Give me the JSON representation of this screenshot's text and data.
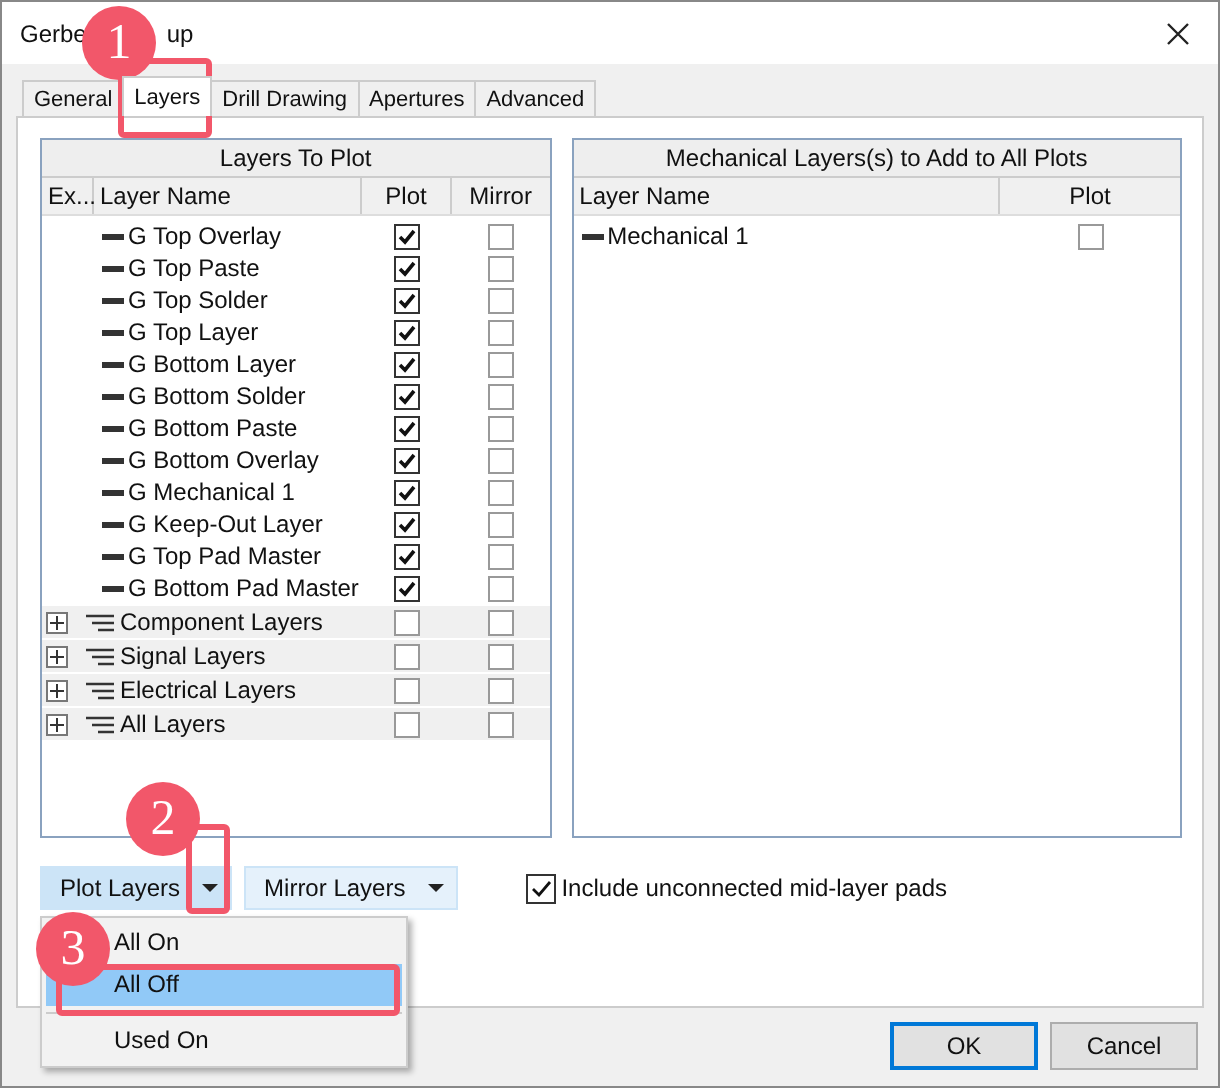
{
  "window": {
    "title_parts": [
      "Gerbe",
      "up"
    ]
  },
  "tabs": [
    {
      "label": "General",
      "selected": false
    },
    {
      "label": "Layers",
      "selected": true
    },
    {
      "label": "Drill Drawing",
      "selected": false
    },
    {
      "label": "Apertures",
      "selected": false
    },
    {
      "label": "Advanced",
      "selected": false
    }
  ],
  "layers_panel": {
    "title": "Layers To Plot",
    "columns": [
      "Ex...",
      "Layer Name",
      "Plot",
      "Mirror"
    ],
    "rows": [
      {
        "kind": "layer",
        "prefix": "G",
        "name": "Top Overlay",
        "plot": true,
        "mirror": false
      },
      {
        "kind": "layer",
        "prefix": "G",
        "name": "Top Paste",
        "plot": true,
        "mirror": false
      },
      {
        "kind": "layer",
        "prefix": "G",
        "name": "Top Solder",
        "plot": true,
        "mirror": false
      },
      {
        "kind": "layer",
        "prefix": "G",
        "name": "Top Layer",
        "plot": true,
        "mirror": false
      },
      {
        "kind": "layer",
        "prefix": "G",
        "name": "Bottom Layer",
        "plot": true,
        "mirror": false
      },
      {
        "kind": "layer",
        "prefix": "G",
        "name": "Bottom Solder",
        "plot": true,
        "mirror": false
      },
      {
        "kind": "layer",
        "prefix": "G",
        "name": "Bottom Paste",
        "plot": true,
        "mirror": false
      },
      {
        "kind": "layer",
        "prefix": "G",
        "name": "Bottom Overlay",
        "plot": true,
        "mirror": false
      },
      {
        "kind": "layer",
        "prefix": "G",
        "name": "Mechanical 1",
        "plot": true,
        "mirror": false
      },
      {
        "kind": "layer",
        "prefix": "G",
        "name": "Keep-Out Layer",
        "plot": true,
        "mirror": false
      },
      {
        "kind": "layer",
        "prefix": "G",
        "name": "Top Pad Master",
        "plot": true,
        "mirror": false
      },
      {
        "kind": "layer",
        "prefix": "G",
        "name": "Bottom Pad Master",
        "plot": true,
        "mirror": false
      },
      {
        "kind": "group",
        "name": "Component Layers",
        "expanded": false,
        "plot": false,
        "mirror": false
      },
      {
        "kind": "group",
        "name": "Signal Layers",
        "expanded": false,
        "plot": false,
        "mirror": false
      },
      {
        "kind": "group",
        "name": "Electrical Layers",
        "expanded": false,
        "plot": false,
        "mirror": false
      },
      {
        "kind": "group",
        "name": "All Layers",
        "expanded": false,
        "plot": false,
        "mirror": false
      }
    ]
  },
  "mechanical_panel": {
    "title": "Mechanical Layers(s) to Add to All Plots",
    "columns": [
      "Layer Name",
      "Plot"
    ],
    "rows": [
      {
        "name": "Mechanical 1",
        "plot": false
      }
    ]
  },
  "dropdown_buttons": [
    {
      "label": "Plot Layers",
      "open": true
    },
    {
      "label": "Mirror Layers",
      "open": false
    }
  ],
  "include_unconnected": {
    "label": "Include unconnected mid-layer pads",
    "checked": true
  },
  "menu": {
    "items": [
      {
        "label": "All On",
        "selected": false,
        "separator_before": false
      },
      {
        "label": "All Off",
        "selected": true,
        "separator_before": false
      },
      {
        "label": "Used On",
        "selected": false,
        "separator_before": true
      }
    ]
  },
  "dialog_buttons": [
    {
      "label": "OK",
      "default": true
    },
    {
      "label": "Cancel",
      "default": false
    }
  ],
  "annotations": [
    {
      "number": "1"
    },
    {
      "number": "2"
    },
    {
      "number": "3"
    }
  ]
}
